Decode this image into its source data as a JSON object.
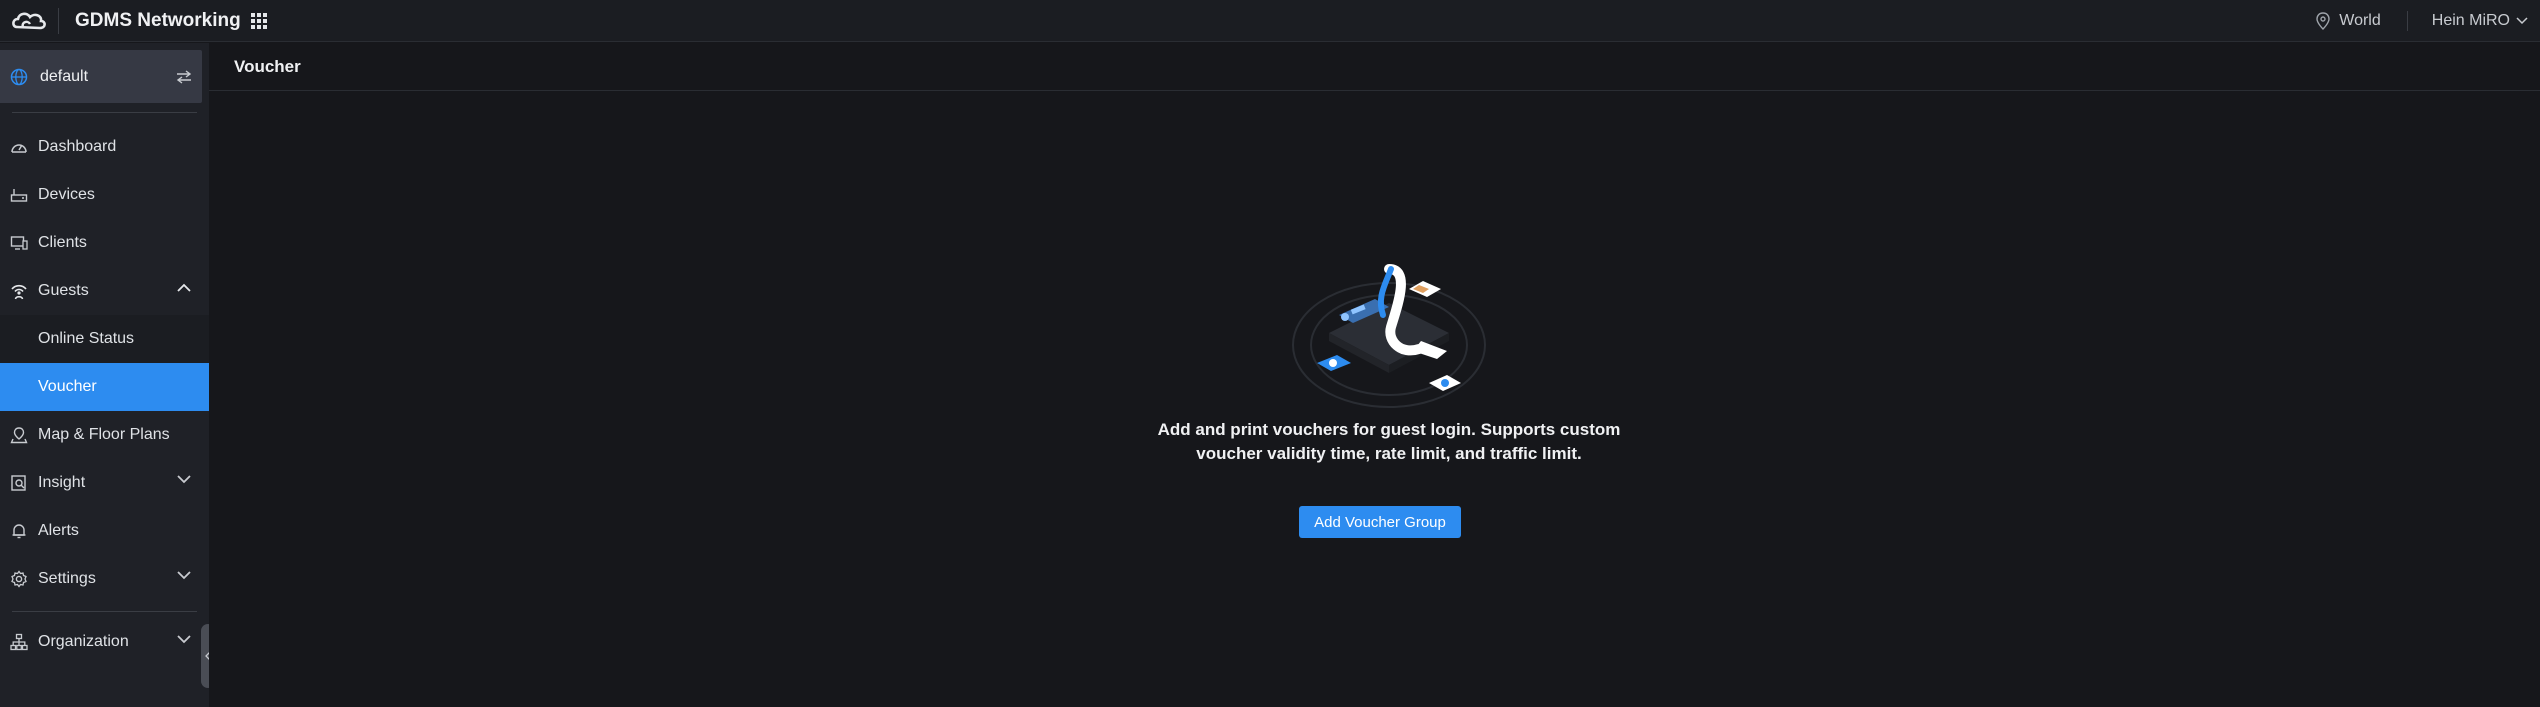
{
  "header": {
    "app_title": "GDMS Networking",
    "region": "World",
    "user": "Hein MiRO"
  },
  "sidebar": {
    "site": "default",
    "items": [
      {
        "label": "Dashboard",
        "icon": "dashboard-icon"
      },
      {
        "label": "Devices",
        "icon": "router-icon"
      },
      {
        "label": "Clients",
        "icon": "monitor-icon"
      },
      {
        "label": "Guests",
        "icon": "wifi-person-icon",
        "expanded": true,
        "children": [
          {
            "label": "Online Status"
          },
          {
            "label": "Voucher",
            "active": true
          }
        ]
      },
      {
        "label": "Map & Floor Plans",
        "icon": "map-pin-icon"
      },
      {
        "label": "Insight",
        "icon": "insight-icon",
        "expandable": true
      },
      {
        "label": "Alerts",
        "icon": "bell-icon"
      },
      {
        "label": "Settings",
        "icon": "gear-icon",
        "expandable": true
      },
      {
        "label": "Organization",
        "icon": "org-tree-icon",
        "expandable": true
      }
    ]
  },
  "main": {
    "title": "Voucher",
    "empty_text_line1": "Add and print vouchers for guest login. Supports custom",
    "empty_text_line2": "voucher validity time, rate limit, and traffic limit.",
    "add_button": "Add Voucher Group"
  },
  "colors": {
    "accent": "#2d8cf0",
    "background": "#16171b",
    "sidebar": "#1f2127"
  }
}
